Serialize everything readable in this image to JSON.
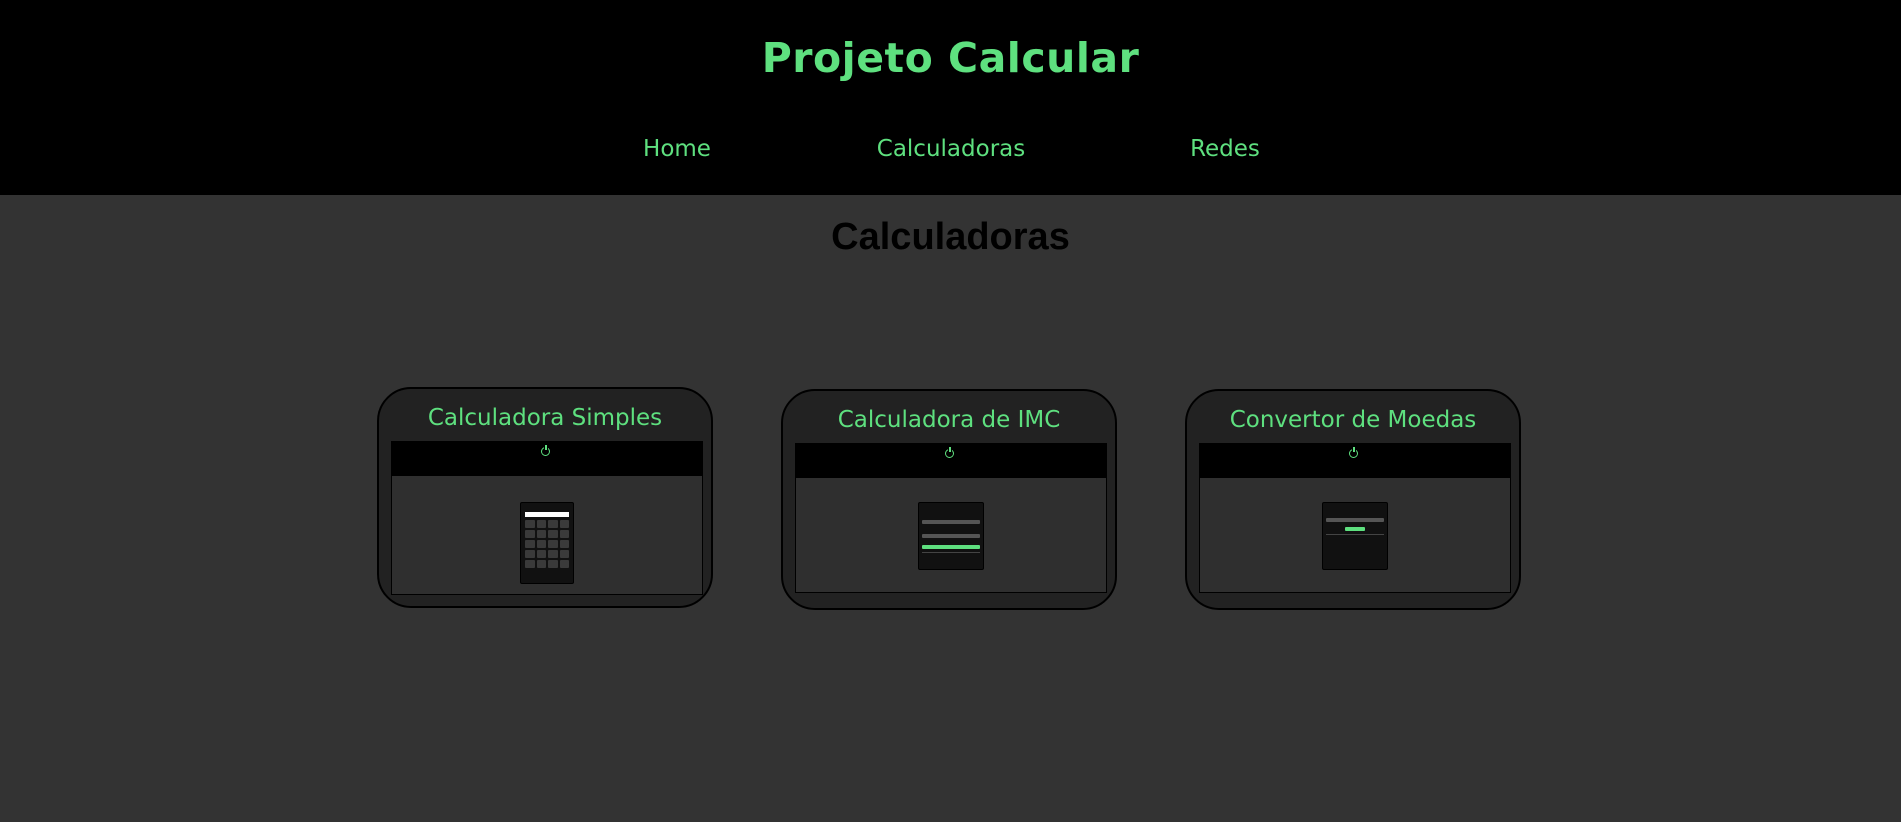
{
  "header": {
    "title": "Projeto Calcular",
    "nav": [
      "Home",
      "Calculadoras",
      "Redes"
    ]
  },
  "main": {
    "heading": "Calculadoras",
    "cards": [
      {
        "title": "Calculadora Simples"
      },
      {
        "title": "Calculadora de IMC"
      },
      {
        "title": "Convertor de Moedas"
      }
    ]
  },
  "colors": {
    "accent": "#5ee07f",
    "header_bg": "#000000",
    "page_bg": "#333333",
    "card_bg": "#222222"
  }
}
